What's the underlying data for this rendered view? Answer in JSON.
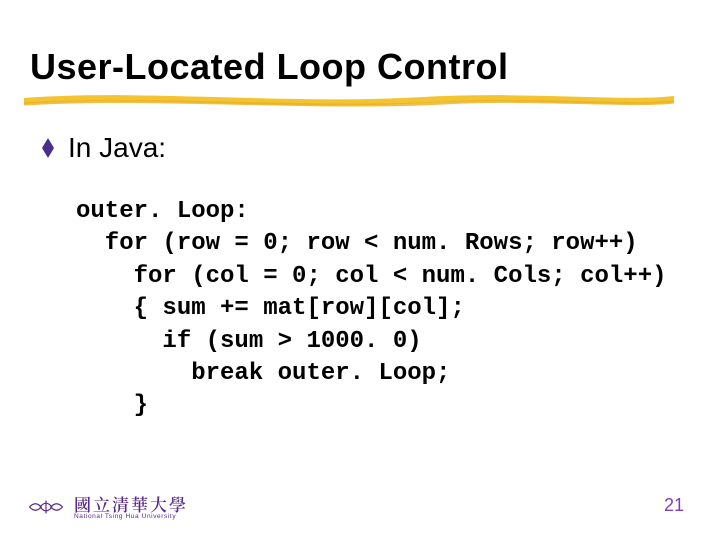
{
  "title": "User-Located Loop Control",
  "bullet": "In Java:",
  "code_lines": [
    "outer. Loop:",
    "  for (row = 0; row < num. Rows; row++)",
    "    for (col = 0; col < num. Cols; col++)",
    "    { sum += mat[row][col];",
    "      if (sum > 1000. 0)",
    "        break outer. Loop;",
    "    }"
  ],
  "footer": {
    "org_cjk": "國立清華大學",
    "org_eng": "National Tsing Hua University"
  },
  "page_number": "21",
  "colors": {
    "accent_purple": "#4a2f8f",
    "underline_yellow": "#f4c430",
    "page_purple": "#7a3fbf"
  }
}
